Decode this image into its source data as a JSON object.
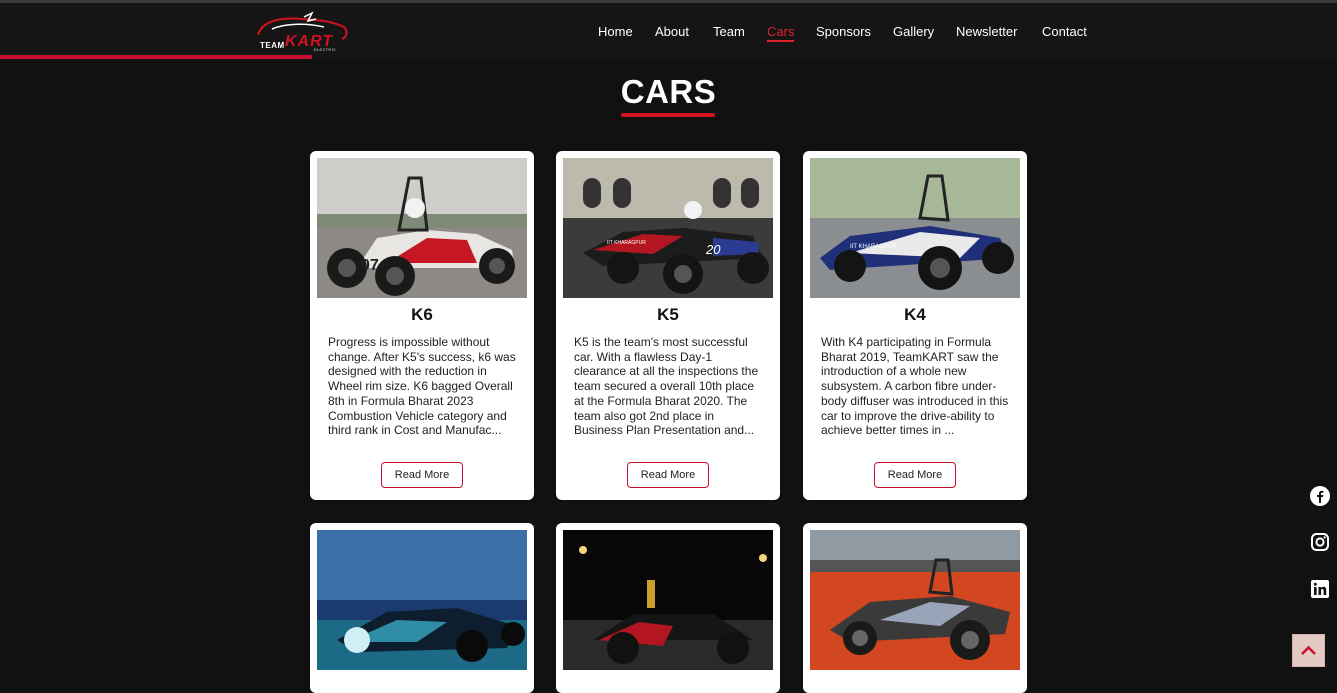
{
  "brand": {
    "logo_team": "TEAM",
    "logo_kart": "KART",
    "logo_electric": "ELECTRIC",
    "accent": "#d3121f"
  },
  "nav": {
    "items": [
      {
        "label": "Home"
      },
      {
        "label": "About"
      },
      {
        "label": "Team"
      },
      {
        "label": "Cars",
        "active": true
      },
      {
        "label": "Sponsors"
      },
      {
        "label": "Gallery"
      },
      {
        "label": "Newsletter"
      },
      {
        "label": "Contact"
      }
    ]
  },
  "page": {
    "title": "CARS"
  },
  "cars": [
    {
      "name": "K6",
      "description": "Progress is impossible without change. After K5's success, k6 was designed with the reduction in Wheel rim size. K6 bagged Overall 8th in Formula Bharat 2023 Combustion Vehicle category and third rank in Cost and Manufac...",
      "button": "Read More"
    },
    {
      "name": "K5",
      "description": "K5 is the team's most successful car. With a flawless Day-1 clearance at all the inspections the team secured a overall 10th place at the Formula Bharat 2020. The team also got 2nd place in Business Plan Presentation and...",
      "button": "Read More"
    },
    {
      "name": "K4",
      "description": "With K4 participating in Formula Bharat 2019, TeamKART saw the introduction of a whole new subsystem. A carbon fibre under-body diffuser was introduced in this car to improve the drive-ability to achieve better times in ...",
      "button": "Read More"
    }
  ],
  "car_images": {
    "k6_number": "07",
    "k5_number": "20",
    "k5_side_text": "IIT KHARAGPUR",
    "k4_side_text": "IIT KHARAGPUR"
  },
  "social": {
    "icons": [
      "facebook-icon",
      "instagram-icon",
      "linkedin-icon"
    ]
  },
  "scroll_top": {
    "icon": "chevron-up-icon"
  }
}
